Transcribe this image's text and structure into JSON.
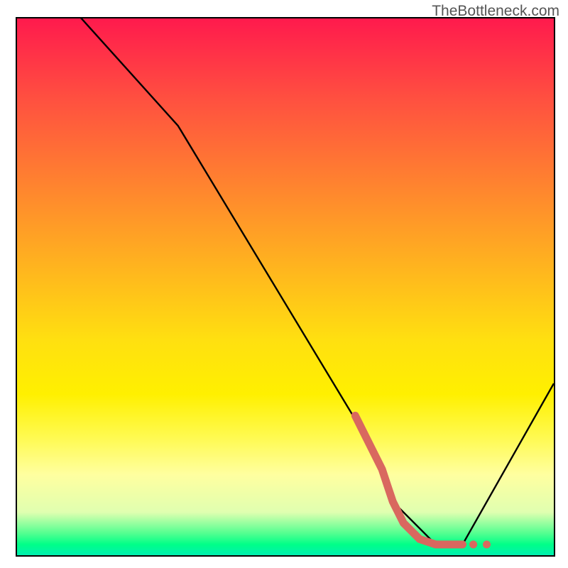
{
  "watermark": "TheBottleneck.com",
  "chart_data": {
    "type": "line",
    "title": "",
    "xlabel": "",
    "ylabel": "",
    "xlim": [
      0,
      100
    ],
    "ylim": [
      0,
      100
    ],
    "series": [
      {
        "name": "bottleneck-curve",
        "x": [
          0,
          12,
          30,
          65,
          70,
          78,
          83,
          100
        ],
        "values": [
          110,
          100,
          80,
          22,
          10,
          2,
          2,
          32
        ]
      }
    ],
    "highlight_segment": {
      "name": "optimal-zone",
      "color": "#d9685f",
      "points_x": [
        63,
        66,
        68,
        69,
        70,
        72,
        75,
        78,
        81,
        83
      ],
      "points_y": [
        26,
        20,
        16,
        13,
        10,
        6,
        3,
        2,
        2,
        2
      ]
    },
    "background": {
      "type": "vertical-gradient",
      "stops": [
        {
          "pos": 0.0,
          "color": "#ff1a4d"
        },
        {
          "pos": 0.3,
          "color": "#ff8030"
        },
        {
          "pos": 0.6,
          "color": "#ffe010"
        },
        {
          "pos": 0.85,
          "color": "#ffffa0"
        },
        {
          "pos": 0.96,
          "color": "#50ff90"
        },
        {
          "pos": 1.0,
          "color": "#00efb0"
        }
      ]
    }
  }
}
